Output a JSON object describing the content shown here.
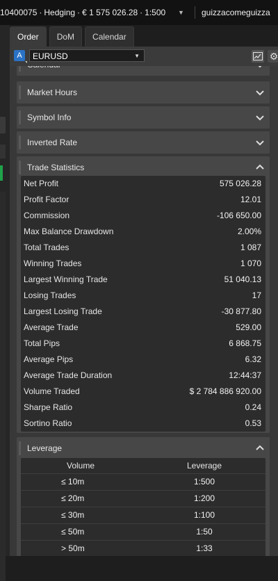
{
  "topbar": {
    "account": "10400075 ∙ Hedging ∙ € 1 575 026.28 ∙ 1:500",
    "user": "guizzacomeguizza"
  },
  "tabs": [
    "Order",
    "DoM",
    "Calendar"
  ],
  "symbol": {
    "badge": "A",
    "name": "EURUSD"
  },
  "sections": {
    "calendar": "Calendar",
    "market_hours": "Market Hours",
    "symbol_info": "Symbol Info",
    "inverted_rate": "Inverted Rate",
    "trade_statistics": "Trade Statistics",
    "leverage": "Leverage"
  },
  "trade_statistics": [
    {
      "label": "Net Profit",
      "value": "575 026.28"
    },
    {
      "label": "Profit Factor",
      "value": "12.01"
    },
    {
      "label": "Commission",
      "value": "-106 650.00"
    },
    {
      "label": "Max Balance Drawdown",
      "value": "2.00%"
    },
    {
      "label": "Total Trades",
      "value": "1 087"
    },
    {
      "label": "Winning Trades",
      "value": "1 070"
    },
    {
      "label": "Largest Winning Trade",
      "value": "51 040.13"
    },
    {
      "label": "Losing Trades",
      "value": "17"
    },
    {
      "label": "Largest Losing Trade",
      "value": "-30 877.80"
    },
    {
      "label": "Average Trade",
      "value": "529.00"
    },
    {
      "label": "Total Pips",
      "value": "6 868.75"
    },
    {
      "label": "Average Pips",
      "value": "6.32"
    },
    {
      "label": "Average Trade Duration",
      "value": "12:44:37"
    },
    {
      "label": "Volume Traded",
      "value": "$ 2 784 886 920.00"
    },
    {
      "label": "Sharpe Ratio",
      "value": "0.24"
    },
    {
      "label": "Sortino Ratio",
      "value": "0.53"
    }
  ],
  "leverage": {
    "headers": [
      "Volume",
      "Leverage"
    ],
    "rows": [
      {
        "volume": "≤ 10m",
        "leverage": "1:500"
      },
      {
        "volume": "≤ 20m",
        "leverage": "1:200"
      },
      {
        "volume": "≤ 30m",
        "leverage": "1:100"
      },
      {
        "volume": "≤ 50m",
        "leverage": "1:50"
      },
      {
        "volume": "> 50m",
        "leverage": "1:33"
      }
    ]
  },
  "icons": {
    "account_caret": "caret-down-icon",
    "symbol_caret": "caret-down-icon",
    "chart_edit": "chart-edit-icon",
    "settings": "gear-icon",
    "chevron_down": "chevron-down-icon",
    "chevron_up": "chevron-up-icon"
  },
  "colors": {
    "accent": "#2a72c5",
    "positive": "#1fa24a",
    "background": "#1e1e1e"
  }
}
